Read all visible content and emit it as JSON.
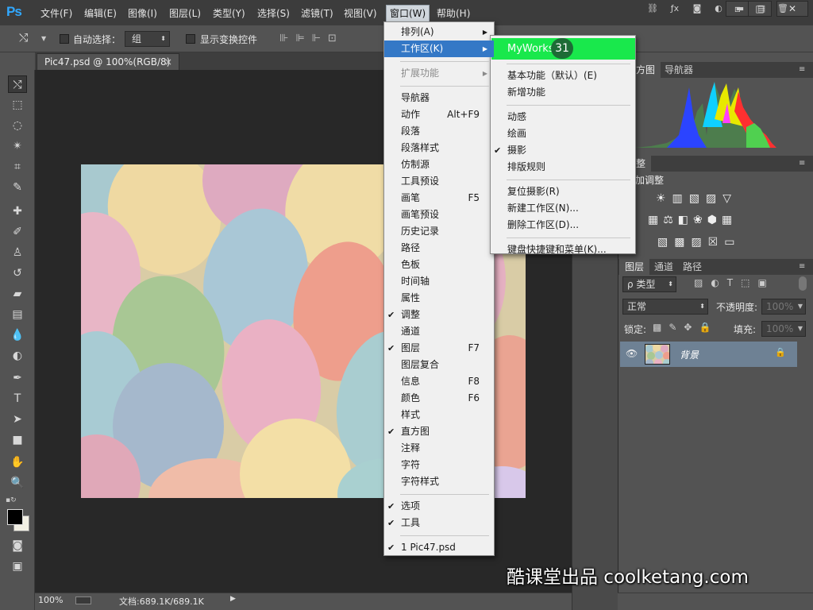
{
  "app": {
    "logo": "Ps"
  },
  "menubar": {
    "items": [
      "文件(F)",
      "编辑(E)",
      "图像(I)",
      "图层(L)",
      "类型(Y)",
      "选择(S)",
      "滤镜(T)",
      "视图(V)",
      "窗口(W)",
      "帮助(H)"
    ],
    "active_index": 8,
    "window_controls": [
      "▫",
      "□",
      "✕"
    ]
  },
  "options": {
    "auto_select_label": "自动选择：",
    "auto_select_value": "组",
    "show_transform_label": "显示变换控件"
  },
  "document": {
    "tab_label": "Pic47.psd @ 100%(RGB/8)",
    "close_icon": "×"
  },
  "status": {
    "zoom": "100%",
    "doc_info": "文档:689.1K/689.1K"
  },
  "window_menu": {
    "items": [
      {
        "label": "排列(A)",
        "arrow": "▶"
      },
      {
        "label": "工作区(K)",
        "arrow": "▶",
        "highlighted": true
      },
      {
        "sep": true
      },
      {
        "label": "扩展功能",
        "arrow": "▶",
        "disabled": true
      },
      {
        "sep": true
      },
      {
        "label": "导航器"
      },
      {
        "label": "动作",
        "key": "Alt+F9"
      },
      {
        "label": "段落"
      },
      {
        "label": "段落样式"
      },
      {
        "label": "仿制源"
      },
      {
        "label": "工具预设"
      },
      {
        "label": "画笔",
        "key": "F5"
      },
      {
        "label": "画笔预设"
      },
      {
        "label": "历史记录"
      },
      {
        "label": "路径"
      },
      {
        "label": "色板"
      },
      {
        "label": "时间轴"
      },
      {
        "label": "属性"
      },
      {
        "label": "调整",
        "check": "✔"
      },
      {
        "label": "通道"
      },
      {
        "label": "图层",
        "key": "F7",
        "check": "✔"
      },
      {
        "label": "图层复合"
      },
      {
        "label": "信息",
        "key": "F8"
      },
      {
        "label": "颜色",
        "key": "F6"
      },
      {
        "label": "样式"
      },
      {
        "label": "直方图",
        "check": "✔"
      },
      {
        "label": "注释"
      },
      {
        "label": "字符"
      },
      {
        "label": "字符样式"
      },
      {
        "sep": true
      },
      {
        "label": "选项",
        "check": "✔"
      },
      {
        "label": "工具",
        "check": "✔"
      },
      {
        "sep": true
      },
      {
        "label": "1 Pic47.psd",
        "check": "✔"
      }
    ]
  },
  "workspace_submenu": {
    "items": [
      {
        "label": "MyWorks",
        "target": true
      },
      {
        "sep": true
      },
      {
        "label": "基本功能（默认）(E)"
      },
      {
        "label": "新增功能"
      },
      {
        "sep": true
      },
      {
        "label": "动感"
      },
      {
        "label": "绘画"
      },
      {
        "label": "摄影",
        "check": "✔"
      },
      {
        "label": "排版规则"
      },
      {
        "sep": true
      },
      {
        "label": "复位摄影(R)"
      },
      {
        "label": "新建工作区(N)..."
      },
      {
        "label": "删除工作区(D)..."
      },
      {
        "sep": true
      },
      {
        "label": "键盘快捷键和菜单(K)..."
      }
    ],
    "step_badge": "31"
  },
  "panels": {
    "histogram_tabs": [
      "方图",
      "导航器"
    ],
    "adjust_tab": "整",
    "adjust_title": "加调整",
    "layers_tabs": [
      "图层",
      "通道",
      "路径"
    ],
    "kind_filter": "ρ 类型",
    "blend_mode": "正常",
    "opacity_label": "不透明度:",
    "opacity_value": "100%",
    "lock_label": "锁定:",
    "fill_label": "填充:",
    "fill_value": "100%",
    "layer_name": "背景"
  },
  "watermark": "酷课堂出品 coolketang.com",
  "colors": {
    "menu_highlight": "#3478c6",
    "target_highlight": "#19e84c",
    "badge": "#1d6b36",
    "layer_selected": "#6e8194"
  }
}
